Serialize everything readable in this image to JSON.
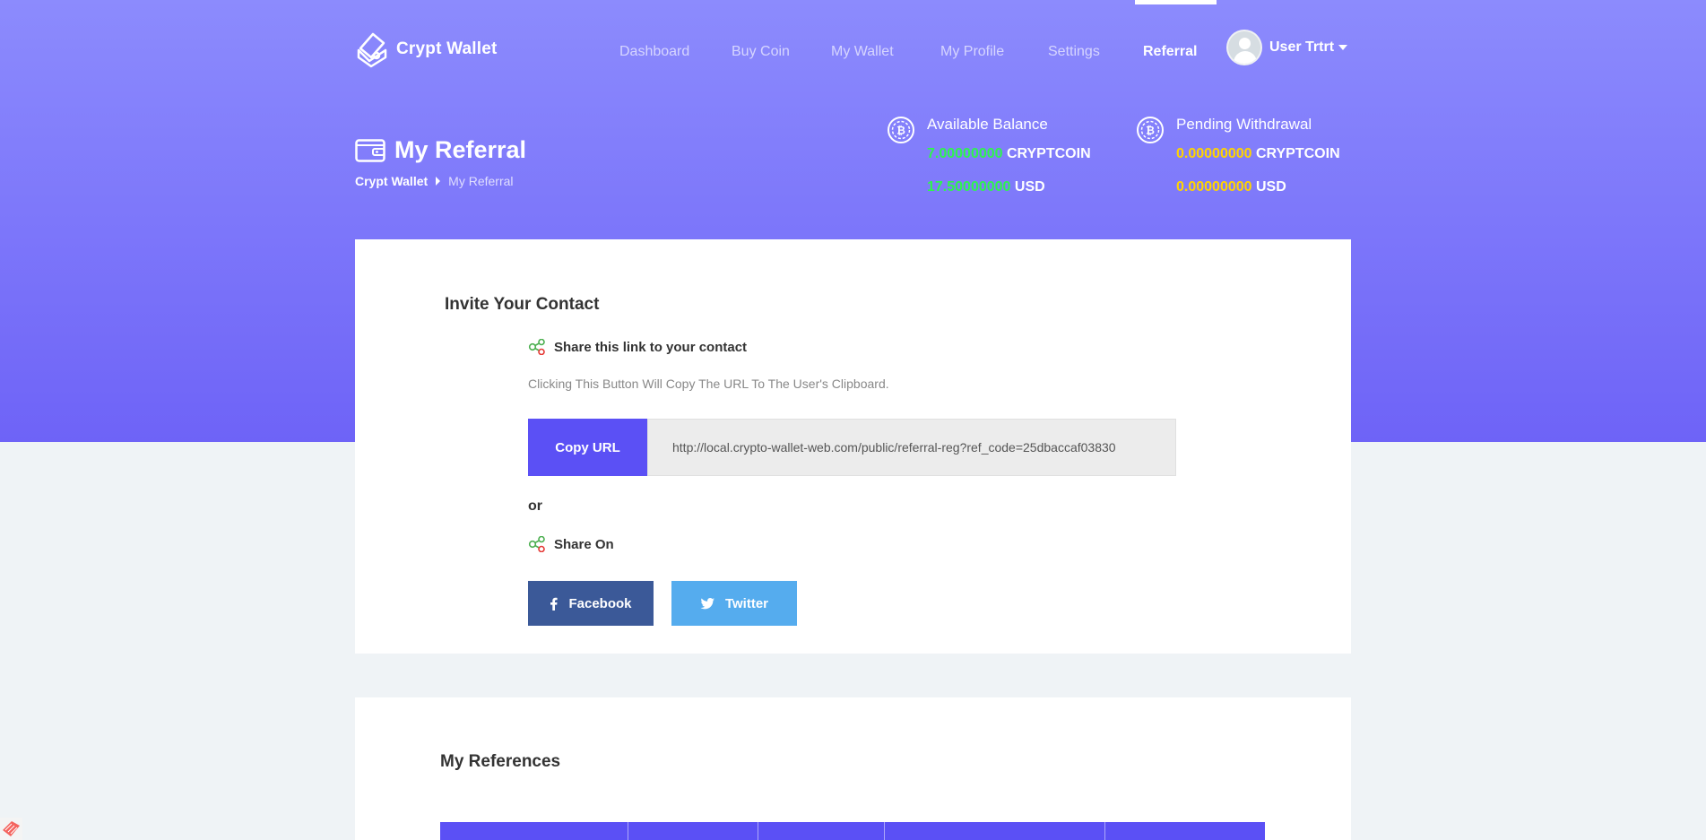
{
  "app": {
    "name": "Crypt Wallet"
  },
  "nav": {
    "items": [
      {
        "label": "Dashboard",
        "active": false
      },
      {
        "label": "Buy Coin",
        "active": false
      },
      {
        "label": "My Wallet",
        "active": false
      },
      {
        "label": "My Profile",
        "active": false
      },
      {
        "label": "Settings",
        "active": false
      },
      {
        "label": "Referral",
        "active": true
      }
    ],
    "user_name": "User Trtrt"
  },
  "page": {
    "title": "My Referral",
    "breadcrumb": [
      "Crypt Wallet",
      "My Referral"
    ]
  },
  "balances": {
    "available": {
      "title": "Available Balance",
      "coin_value": "7.00000000",
      "coin_unit": "CRYPTCOIN",
      "usd_value": "17.50000000",
      "usd_unit": "USD"
    },
    "pending": {
      "title": "Pending Withdrawal",
      "coin_value": "0.00000000",
      "coin_unit": "CRYPTCOIN",
      "usd_value": "0.00000000",
      "usd_unit": "USD"
    }
  },
  "invite": {
    "title": "Invite Your Contact",
    "share_link_label": "Share this link to your contact",
    "hint": "Clicking This Button Will Copy The URL To The User's Clipboard.",
    "copy_button": "Copy URL",
    "url": "http://local.crypto-wallet-web.com/public/referral-reg?ref_code=25dbaccaf03830",
    "or": "or",
    "share_on_label": "Share On",
    "facebook": "Facebook",
    "twitter": "Twitter"
  },
  "references": {
    "title": "My References"
  },
  "colors": {
    "hero_top": "#8c8bfd",
    "hero_bottom": "#6e63f7",
    "accent": "#5b50f5",
    "green_value": "#2ef44e",
    "yellow_value": "#ffd400",
    "facebook": "#3b5998",
    "twitter": "#55acee"
  }
}
